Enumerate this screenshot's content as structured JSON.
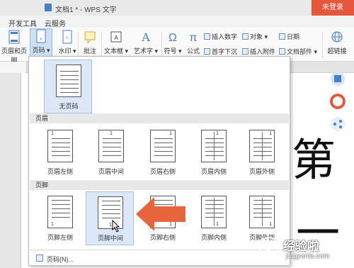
{
  "window": {
    "title": "文档1 * - WPS 文字",
    "login_label": "未登录"
  },
  "menu": {
    "items": [
      "开发工具",
      "云服务"
    ]
  },
  "ribbon": {
    "header_footer": "页眉和页脚",
    "page_number": "页码",
    "watermark": "水印",
    "comment": "批注",
    "textbox": "文本框",
    "wordart": "艺术字",
    "symbol": "符号",
    "formula": "公式",
    "insert_number": "插入数字",
    "object": "对象",
    "date": "日期",
    "drop_cap": "首字下沉",
    "insert_attachment": "插入附件",
    "doc_parts": "文档部件",
    "hyperlink": "超链接"
  },
  "dropdown": {
    "no_page_number": "无页码",
    "header_section": "页眉",
    "footer_section": "页脚",
    "header_items": [
      "页眉左侧",
      "页眉中间",
      "页眉右侧",
      "页眉内侧",
      "页眉外侧"
    ],
    "footer_items": [
      "页脚左侧",
      "页脚中间",
      "页脚右侧",
      "页脚内侧",
      "页脚外侧"
    ],
    "page_number_more": "页码(N)...",
    "thumb_number": "1"
  },
  "document": {
    "char1": "第",
    "char2": "一"
  },
  "watermark_site": {
    "text": "经验啦",
    "url": "jingyanla.com"
  },
  "colors": {
    "accent": "#e5573d",
    "arrow": "#e8643c",
    "selected": "#dce8f7"
  }
}
